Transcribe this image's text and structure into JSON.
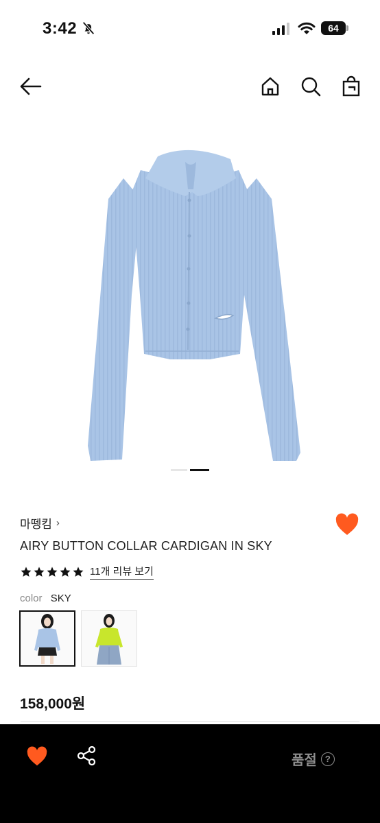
{
  "status_bar": {
    "time": "3:42",
    "battery": "64"
  },
  "product": {
    "brand": "마뗑킴",
    "brand_chevron": "›",
    "name": "AIRY BUTTON COLLAR CARDIGAN IN SKY",
    "rating_stars": 5,
    "review_link": "11개 리뷰 보기",
    "color_label": "color",
    "color_value": "SKY",
    "price": "158,000원",
    "accent_color": "#FF5A1F",
    "knit_color": "#A9C4E6"
  },
  "gallery": {
    "current_slide": 2,
    "total_slides": 2
  },
  "bottom_bar": {
    "status_label": "품절",
    "help_glyph": "?"
  },
  "icons": {
    "back": "arrow-left-icon",
    "home": "home-icon",
    "search": "search-icon",
    "bag": "shopping-bag-icon",
    "like": "heart-icon",
    "share": "share-icon",
    "help": "question-circle-icon"
  }
}
